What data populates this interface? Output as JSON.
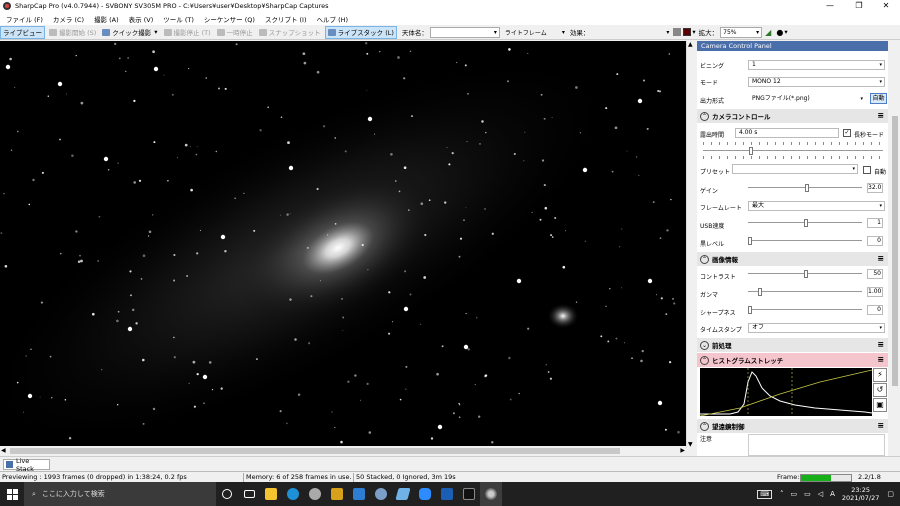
{
  "window": {
    "title": "SharpCap Pro (v4.0.7944) - SVBONY SV305M PRO - C:¥Users¥user¥Desktop¥SharpCap Captures",
    "min": "—",
    "max": "❐",
    "close": "✕"
  },
  "menu": [
    "ファイル (F)",
    "カメラ (C)",
    "撮影 (A)",
    "表示 (V)",
    "ツール (T)",
    "シーケンサー (Q)",
    "スクリプト (I)",
    "ヘルプ (H)"
  ],
  "toolbar": {
    "live": "ライブビュー",
    "capture_start": "撮影開始 (S)",
    "quick": "クイック撮影",
    "stop": "撮影停止 (T)",
    "pause": "一時停止",
    "snapshot": "スナップショット",
    "livestack": "ライブスタック (L)",
    "target_label": "天体名：",
    "target_value": "",
    "frame_type": "ライトフレーム",
    "effect_label": "効果：",
    "effect_value": "",
    "zoom_label": "拡大：",
    "zoom_value": "75%"
  },
  "panel": {
    "title": "Camera Control Panel",
    "binning_label": "ビニング",
    "binning_value": "1",
    "mode_label": "モード",
    "mode_value": "MONO 12",
    "output_label": "出力形式",
    "output_value": "PNGファイル(*.png)",
    "auto_label": "自動",
    "camera_section": "カメラコントロール",
    "exposure_label": "露出時間",
    "exposure_value": "4.00 s",
    "long_exposure_label": "長秒モード",
    "preset_label": "プリセット",
    "preset_value": "",
    "auto2_label": "自動",
    "gain_label": "ゲイン",
    "gain_value": "32.0",
    "framerate_label": "フレームレート",
    "framerate_value": "最大",
    "usb_label": "USB速度",
    "usb_value": "1",
    "black_label": "黒レベル",
    "black_value": "0",
    "image_section": "画像情報",
    "contrast_label": "コントラスト",
    "contrast_value": "50",
    "gamma_label": "ガンマ",
    "gamma_value": "1.00",
    "sharpness_label": "シャープネス",
    "sharpness_value": "0",
    "timestamp_label": "タイムスタンプ",
    "timestamp_value": "オフ",
    "preprocess_section": "前処理",
    "histogram_section": "ヒストグラムストレッチ",
    "telescope_section": "望遠鏡制御",
    "focus_label": "注意"
  },
  "bottom": {
    "tab": "Live Stack"
  },
  "status": {
    "previewing": "Previewing : 1993 frames (0 dropped) in 1:38:24, 0.2 fps",
    "memory": "Memory: 6 of 258 frames in use.",
    "stacked": "50 Stacked, 0 Ignored, 3m 19s",
    "frame_label": "Frame:",
    "frame_ratio": "2.2/1.8",
    "frame_fill": 0.6
  },
  "taskbar": {
    "search": "ここに入力して検索",
    "time": "23:25",
    "date": "2021/07/27",
    "ime": "A"
  },
  "colors": {
    "accent": "#cce4f7",
    "histogram_header": "#f4c5cc",
    "frame_bar": "#18b018",
    "taskbar": "#202020"
  }
}
